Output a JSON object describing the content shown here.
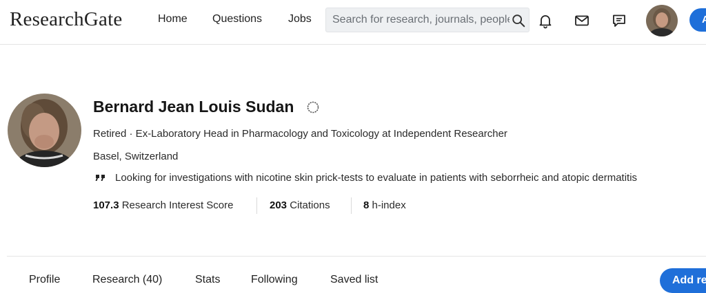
{
  "header": {
    "logo": "ResearchGate",
    "nav": [
      "Home",
      "Questions",
      "Jobs"
    ],
    "search_placeholder": "Search for research, journals, people",
    "cta_label": "A"
  },
  "profile": {
    "name": "Bernard Jean Louis Sudan",
    "position": "Retired · Ex-Laboratory Head in Pharmacology and Toxicology at Independent Researcher",
    "location": "Basel, Switzerland",
    "quote": "Looking for investigations with nicotine skin prick-tests to evaluate in patients with seborrheic and atopic dermatitis",
    "stats": [
      {
        "value": "107.3",
        "label": "Research Interest Score"
      },
      {
        "value": "203",
        "label": "Citations"
      },
      {
        "value": "8",
        "label": "h-index"
      }
    ]
  },
  "tabs": [
    "Profile",
    "Research (40)",
    "Stats",
    "Following",
    "Saved list"
  ],
  "add_button_label": "Add re",
  "colors": {
    "accent": "#1f6fd9",
    "search_bg": "#eef0f2",
    "divider": "#e5e5e5"
  },
  "icons": [
    "search-icon",
    "bell-icon",
    "mail-icon",
    "chat-icon",
    "user-avatar",
    "verified-badge-icon",
    "quote-icon"
  ]
}
